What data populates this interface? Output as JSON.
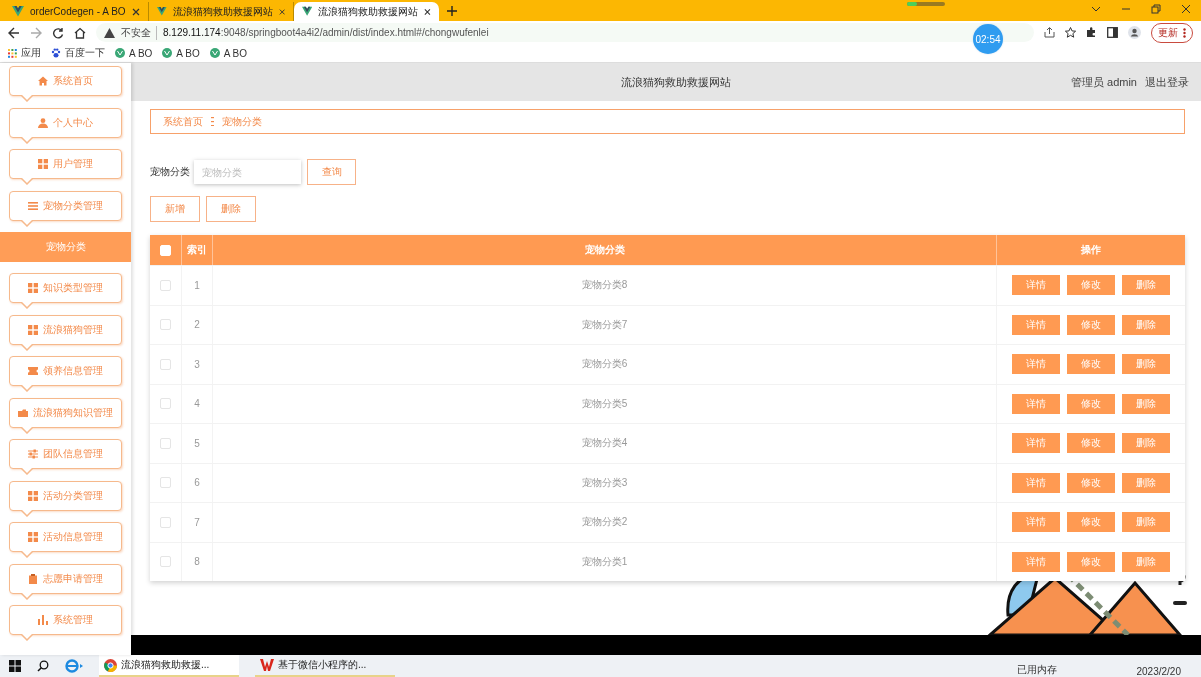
{
  "browser": {
    "tabs": [
      {
        "title": "orderCodegen - A BO",
        "selected": false
      },
      {
        "title": "流浪猫狗救助救援网站",
        "selected": false
      },
      {
        "title": "流浪猫狗救助救援网站",
        "selected": true
      }
    ],
    "security": "不安全",
    "url_host": "8.129.11.174",
    "url_rest": ":9048/springboot4a4i2/admin/dist/index.html#/chongwufenlei",
    "update_button": "更新",
    "bookmarks": [
      "应用",
      "百度一下",
      "A BO",
      "A BO",
      "A BO"
    ]
  },
  "timer": "02:54",
  "header": {
    "title": "流浪猫狗救助救援网站",
    "user": "管理员 admin",
    "logout": "退出登录"
  },
  "sidebar": {
    "items": [
      {
        "label": "系统首页",
        "selected": false
      },
      {
        "label": "个人中心",
        "selected": false
      },
      {
        "label": "用户管理",
        "selected": false
      },
      {
        "label": "宠物分类管理",
        "selected": false,
        "children": [
          {
            "label": "宠物分类",
            "selected": true
          }
        ]
      },
      {
        "label": "知识类型管理",
        "selected": false
      },
      {
        "label": "流浪猫狗管理",
        "selected": false
      },
      {
        "label": "领养信息管理",
        "selected": false
      },
      {
        "label": "流浪猫狗知识管理",
        "selected": false
      },
      {
        "label": "团队信息管理",
        "selected": false
      },
      {
        "label": "活动分类管理",
        "selected": false
      },
      {
        "label": "活动信息管理",
        "selected": false
      },
      {
        "label": "志愿申请管理",
        "selected": false
      },
      {
        "label": "系统管理",
        "selected": false
      }
    ]
  },
  "breadcrumb": [
    "系统首页",
    "宠物分类"
  ],
  "search": {
    "label": "宠物分类",
    "placeholder": "宠物分类",
    "button": "查询"
  },
  "actions": [
    "新增",
    "删除"
  ],
  "table": {
    "columns": [
      "索引",
      "宠物分类",
      "操作"
    ],
    "header_checked": false,
    "rows": [
      {
        "index": "1",
        "name": "宠物分类8",
        "checked": false,
        "buttons": [
          "详情",
          "修改",
          "删除"
        ]
      },
      {
        "index": "2",
        "name": "宠物分类7",
        "checked": false,
        "buttons": [
          "详情",
          "修改",
          "删除"
        ]
      },
      {
        "index": "3",
        "name": "宠物分类6",
        "checked": false,
        "buttons": [
          "详情",
          "修改",
          "删除"
        ]
      },
      {
        "index": "4",
        "name": "宠物分类5",
        "checked": false,
        "buttons": [
          "详情",
          "修改",
          "删除"
        ]
      },
      {
        "index": "5",
        "name": "宠物分类4",
        "checked": false,
        "buttons": [
          "详情",
          "修改",
          "删除"
        ]
      },
      {
        "index": "6",
        "name": "宠物分类3",
        "checked": false,
        "buttons": [
          "详情",
          "修改",
          "删除"
        ]
      },
      {
        "index": "7",
        "name": "宠物分类2",
        "checked": false,
        "buttons": [
          "详情",
          "修改",
          "删除"
        ]
      },
      {
        "index": "8",
        "name": "宠物分类1",
        "checked": false,
        "buttons": [
          "详情",
          "修改",
          "删除"
        ]
      }
    ]
  },
  "taskbar": {
    "tasks": [
      {
        "title": "流浪猫狗救助救援...",
        "selected": true
      },
      {
        "title": "基于微信小程序的...",
        "selected": false
      }
    ],
    "memory": "已用内存",
    "date": "2023/2/20"
  }
}
